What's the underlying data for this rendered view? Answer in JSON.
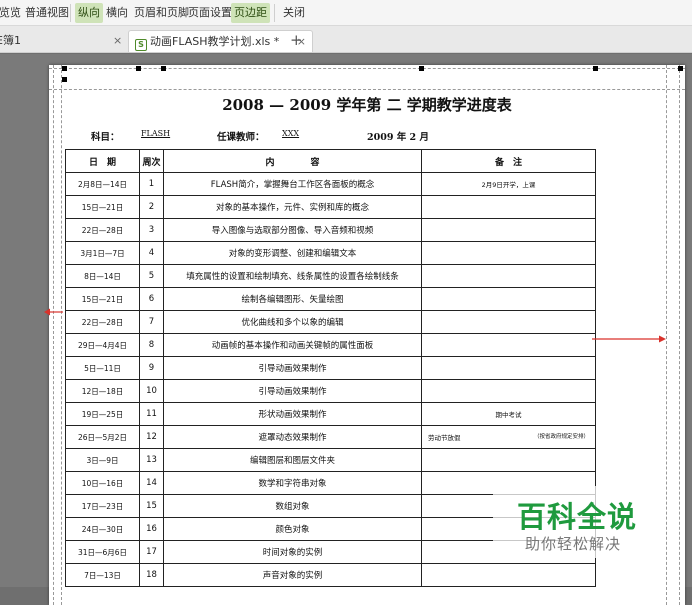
{
  "ribbon": {
    "items": [
      {
        "label": "览览",
        "active": false
      },
      {
        "label": "普通视图",
        "active": false
      },
      {
        "label": "纵向",
        "active": true
      },
      {
        "label": "横向",
        "active": false
      },
      {
        "label": "页眉和页脚",
        "active": false
      },
      {
        "label": "页面设置",
        "active": false
      },
      {
        "label": "页边距",
        "active": true
      },
      {
        "label": "关闭",
        "active": false
      }
    ]
  },
  "tabs": [
    {
      "label": "E簿1",
      "close": "×"
    },
    {
      "label": "动画FLASH教学计划.xls *",
      "close": "×",
      "icon": "S"
    }
  ],
  "new_tab": "+",
  "document": {
    "title": "2008 — 2009 学年第 二 学期教学进度表",
    "subject_label": "科目：",
    "subject_value": "FLASH",
    "teacher_label": "任课教师：",
    "teacher_value": "XXX",
    "date_text": "2009 年 2 月"
  },
  "table": {
    "headers": [
      "日　期",
      "周次",
      "内　　　　容",
      "备　注"
    ],
    "rows": [
      {
        "date": "2月8日—14日",
        "week": "1",
        "content": "FLASH简介，掌握舞台工作区各面板的概念",
        "note": "2月9日开学，上课",
        "note_right": ""
      },
      {
        "date": "15日—21日",
        "week": "2",
        "content": "对象的基本操作，元件、实例和库的概念",
        "note": "",
        "note_right": ""
      },
      {
        "date": "22日—28日",
        "week": "3",
        "content": "导入图像与选取部分图像、导入音频和视频",
        "note": "",
        "note_right": ""
      },
      {
        "date": "3月1日—7日",
        "week": "4",
        "content": "对象的变形调整、创建和编辑文本",
        "note": "",
        "note_right": ""
      },
      {
        "date": "8日—14日",
        "week": "5",
        "content": "填充属性的设置和绘制填充、线条属性的设置各绘制线条",
        "note": "",
        "note_right": ""
      },
      {
        "date": "15日—21日",
        "week": "6",
        "content": "绘制各编辑图形、矢量绘图",
        "note": "",
        "note_right": ""
      },
      {
        "date": "22日—28日",
        "week": "7",
        "content": "优化曲线和多个以象的编辑",
        "note": "",
        "note_right": ""
      },
      {
        "date": "29日—4月4日",
        "week": "8",
        "content": "动画帧的基本操作和动画关键帧的属性面板",
        "note": "",
        "note_right": ""
      },
      {
        "date": "5日—11日",
        "week": "9",
        "content": "引导动画效果制作",
        "note": "",
        "note_right": ""
      },
      {
        "date": "12日—18日",
        "week": "10",
        "content": "引导动画效果制作",
        "note": "",
        "note_right": ""
      },
      {
        "date": "19日—25日",
        "week": "11",
        "content": "形状动画效果制作",
        "note": "期中考试",
        "note_right": ""
      },
      {
        "date": "26日—5月2日",
        "week": "12",
        "content": "遮罩动态效果制作",
        "note": "劳动节放假",
        "note_right": "（按省政府规定安排）"
      },
      {
        "date": "3日—9日",
        "week": "13",
        "content": "编辑图层和图层文件夹",
        "note": "",
        "note_right": ""
      },
      {
        "date": "10日—16日",
        "week": "14",
        "content": "数学和字符串对象",
        "note": "",
        "note_right": ""
      },
      {
        "date": "17日—23日",
        "week": "15",
        "content": "数组对象",
        "note": "",
        "note_right": ""
      },
      {
        "date": "24日—30日",
        "week": "16",
        "content": "颜色对象",
        "note": "",
        "note_right": ""
      },
      {
        "date": "31日—6月6日",
        "week": "17",
        "content": "时间对象的实例",
        "note": "",
        "note_right": ""
      },
      {
        "date": "7日—13日",
        "week": "18",
        "content": "声音对象的实例",
        "note": "",
        "note_right": ""
      }
    ]
  },
  "watermark": {
    "title": "百科全说",
    "subtitle": "助你轻松解决"
  },
  "colors": {
    "accent": "#cfe3b8",
    "arrow": "#d9322b",
    "watermark": "#1f9a3e"
  }
}
